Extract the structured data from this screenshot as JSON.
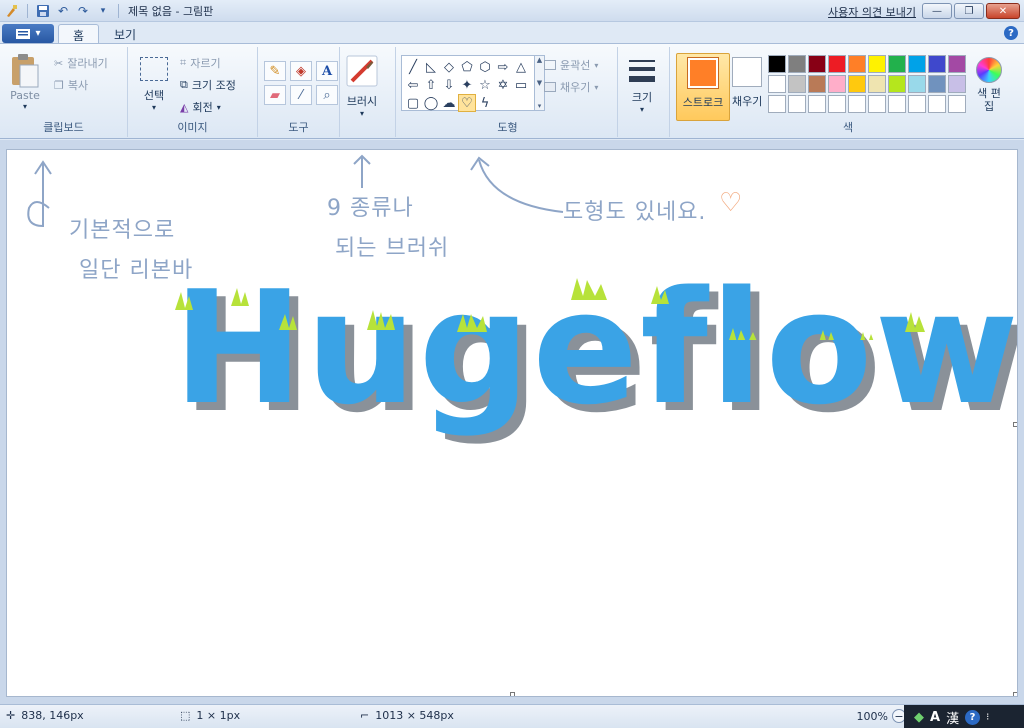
{
  "title_bar": {
    "title": "제목 없음 - 그림판",
    "feedback": "사용자 의견 보내기",
    "minimize": "—",
    "maximize": "❐",
    "close": "✕"
  },
  "tabs": {
    "home": "홈",
    "view": "보기",
    "help": "?"
  },
  "ribbon": {
    "clipboard": {
      "paste": "Paste",
      "cut": "잘라내기",
      "copy": "복사",
      "label": "클립보드"
    },
    "image": {
      "select": "선택",
      "crop": "자르기",
      "resize": "크기 조정",
      "rotate": "회전",
      "label": "이미지"
    },
    "tools": {
      "label": "도구",
      "text_glyph": "A"
    },
    "brushes": {
      "label": "브러시"
    },
    "shapes": {
      "outline": "윤곽선",
      "fill": "채우기",
      "label": "도형"
    },
    "size": {
      "label": "크기"
    },
    "stroke": {
      "label": "스트로크"
    },
    "fill": {
      "label": "채우기"
    },
    "colors": {
      "label": "색",
      "edit": "색 편집",
      "row1": [
        "#000000",
        "#7f7f7f",
        "#880015",
        "#ed1c24",
        "#ff7f27",
        "#fff200",
        "#22b14c",
        "#00a2e8",
        "#3f48cc",
        "#a349a4"
      ],
      "row2": [
        "#ffffff",
        "#c3c3c3",
        "#b97a57",
        "#ffaec9",
        "#ffc90e",
        "#efe4b0",
        "#b5e61d",
        "#99d9ea",
        "#7092be",
        "#c8bfe7"
      ],
      "row3": [
        "#ffffff",
        "#ffffff",
        "#ffffff",
        "#ffffff",
        "#ffffff",
        "#ffffff",
        "#ffffff",
        "#ffffff",
        "#ffffff",
        "#ffffff"
      ]
    }
  },
  "canvas": {
    "note1_line1": "기본적으로",
    "note1_line2": "일단 리본바",
    "note2_line1": "9 종류나",
    "note2_line2": "되는 브러쉬",
    "note3": "도형도 있네요.",
    "heart": "♡",
    "word": "Hugeflow"
  },
  "status": {
    "cursor": "838, 146px",
    "selection": "1 × 1px",
    "canvas_size": "1013 × 548px",
    "zoom": "100%"
  },
  "ime": {
    "lang": "A",
    "hanja": "漢",
    "help": "?"
  }
}
